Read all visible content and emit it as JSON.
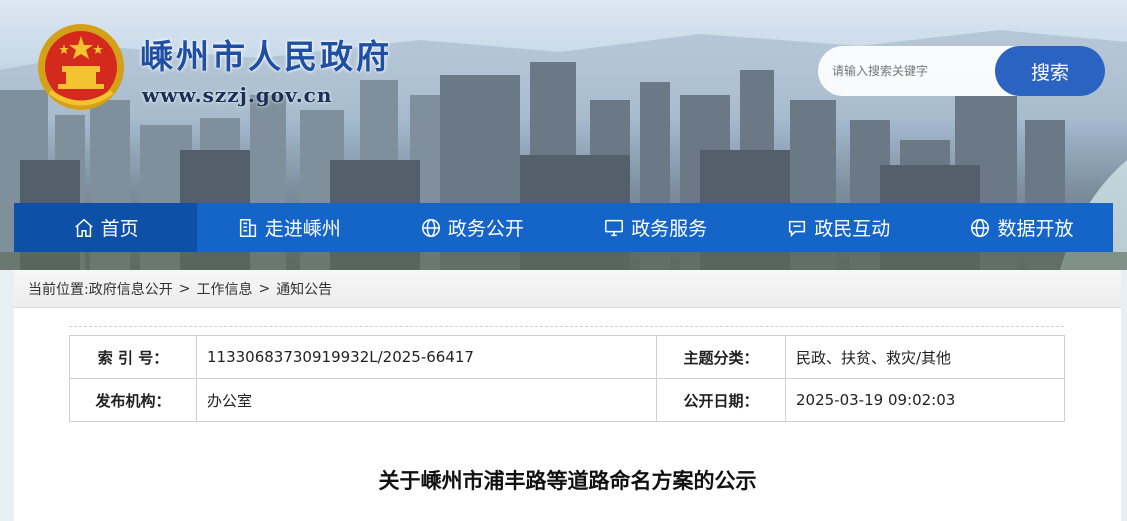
{
  "header": {
    "title": "嵊州市人民政府",
    "url": "www.szzj.gov.cn"
  },
  "search": {
    "placeholder": "请输入搜索关键字",
    "button_label": "搜索"
  },
  "nav": {
    "items": [
      {
        "label": "首页",
        "icon": "home-icon"
      },
      {
        "label": "走进嵊州",
        "icon": "building-icon"
      },
      {
        "label": "政务公开",
        "icon": "globe-icon"
      },
      {
        "label": "政务服务",
        "icon": "monitor-icon"
      },
      {
        "label": "政民互动",
        "icon": "chat-icon"
      },
      {
        "label": "数据开放",
        "icon": "globe-icon"
      }
    ]
  },
  "breadcrumb": {
    "prefix": "当前位置:",
    "items": [
      "政府信息公开",
      "工作信息",
      "通知公告"
    ],
    "separator": ">"
  },
  "meta": {
    "index_label": "索 引 号：",
    "index_value": "11330683730919932L/2025-66417",
    "topic_label": "主题分类：",
    "topic_value": "民政、扶贫、救灾/其他",
    "publisher_label": "发布机构：",
    "publisher_value": "办公室",
    "date_label": "公开日期：",
    "date_value": "2025-03-19 09:02:03"
  },
  "article": {
    "title": "关于嵊州市浦丰路等道路命名方案的公示"
  },
  "colors": {
    "nav_bg": "#1565c8",
    "nav_active": "#0e4fa8",
    "title_blue": "#1f4fa3",
    "search_button": "#2a63c2"
  }
}
